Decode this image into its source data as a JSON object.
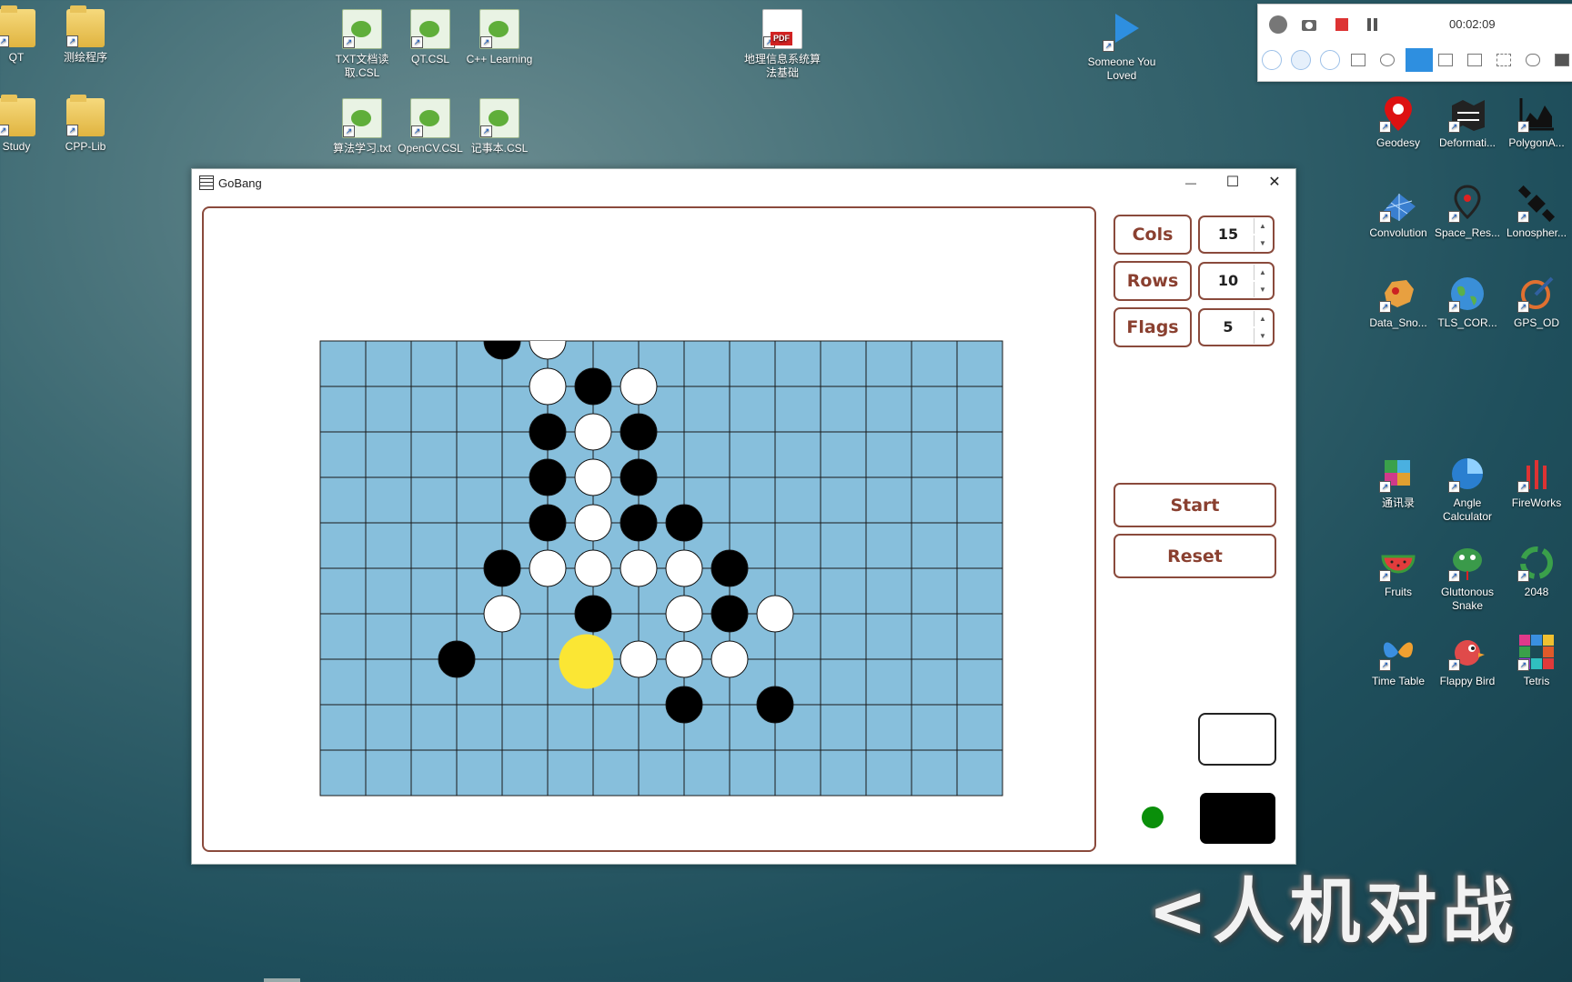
{
  "desktop": {
    "icons": [
      {
        "label": "QT"
      },
      {
        "label": "测绘程序"
      },
      {
        "label": "TXT文档读取.CSL"
      },
      {
        "label": "QT.CSL"
      },
      {
        "label": "C++ Learning"
      },
      {
        "label": "地理信息系统算法基础"
      },
      {
        "label": "Someone You Loved"
      },
      {
        "label": "Study"
      },
      {
        "label": "CPP-Lib"
      },
      {
        "label": "算法学习.txt"
      },
      {
        "label": "OpenCV.CSL"
      },
      {
        "label": "记事本.CSL"
      },
      {
        "label": "Geodesy"
      },
      {
        "label": "Deformati..."
      },
      {
        "label": "PolygonA..."
      },
      {
        "label": "Convolution"
      },
      {
        "label": "Space_Res..."
      },
      {
        "label": "Lonospher..."
      },
      {
        "label": "Data_Sno..."
      },
      {
        "label": "TLS_COR..."
      },
      {
        "label": "GPS_OD"
      },
      {
        "label": "通讯录"
      },
      {
        "label": "Angle Calculator"
      },
      {
        "label": "FireWorks"
      },
      {
        "label": "Fruits"
      },
      {
        "label": "Gluttonous Snake"
      },
      {
        "label": "2048"
      },
      {
        "label": "Time Table"
      },
      {
        "label": "Flappy Bird"
      },
      {
        "label": "Tetris"
      }
    ]
  },
  "recorder": {
    "time": "00:02:09"
  },
  "window": {
    "title": "GoBang",
    "controls": {
      "minimize": "—",
      "maximize": "☐",
      "close": "✕"
    }
  },
  "settings": {
    "cols_label": "Cols",
    "cols_value": "15",
    "rows_label": "Rows",
    "rows_value": "10",
    "flags_label": "Flags",
    "flags_value": "5"
  },
  "actions": {
    "start": "Start",
    "reset": "Reset"
  },
  "board": {
    "cols": 15,
    "rows": 10,
    "colors": {
      "background": "#87bfdc",
      "line": "#1a1a1a",
      "black": "#000000",
      "white": "#ffffff",
      "highlight": "#fbe634"
    },
    "stones": [
      {
        "c": 3,
        "r": 0,
        "color": "black"
      },
      {
        "c": 4,
        "r": 0,
        "color": "white"
      },
      {
        "c": 4,
        "r": 1,
        "color": "white"
      },
      {
        "c": 5,
        "r": 1,
        "color": "black"
      },
      {
        "c": 6,
        "r": 1,
        "color": "white"
      },
      {
        "c": 4,
        "r": 2,
        "color": "black"
      },
      {
        "c": 5,
        "r": 2,
        "color": "white"
      },
      {
        "c": 6,
        "r": 2,
        "color": "black"
      },
      {
        "c": 4,
        "r": 3,
        "color": "black"
      },
      {
        "c": 5,
        "r": 3,
        "color": "white"
      },
      {
        "c": 6,
        "r": 3,
        "color": "black"
      },
      {
        "c": 4,
        "r": 4,
        "color": "black"
      },
      {
        "c": 5,
        "r": 4,
        "color": "white"
      },
      {
        "c": 6,
        "r": 4,
        "color": "black"
      },
      {
        "c": 7,
        "r": 4,
        "color": "black"
      },
      {
        "c": 3,
        "r": 5,
        "color": "black"
      },
      {
        "c": 4,
        "r": 5,
        "color": "white"
      },
      {
        "c": 5,
        "r": 5,
        "color": "white"
      },
      {
        "c": 6,
        "r": 5,
        "color": "white"
      },
      {
        "c": 7,
        "r": 5,
        "color": "white"
      },
      {
        "c": 8,
        "r": 5,
        "color": "black"
      },
      {
        "c": 3,
        "r": 6,
        "color": "white"
      },
      {
        "c": 5,
        "r": 6,
        "color": "black"
      },
      {
        "c": 7,
        "r": 6,
        "color": "white"
      },
      {
        "c": 8,
        "r": 6,
        "color": "black"
      },
      {
        "c": 9,
        "r": 6,
        "color": "white"
      },
      {
        "c": 2,
        "r": 7,
        "color": "black"
      },
      {
        "c": 6,
        "r": 7,
        "color": "white"
      },
      {
        "c": 7,
        "r": 7,
        "color": "white"
      },
      {
        "c": 8,
        "r": 7,
        "color": "white"
      },
      {
        "c": 7,
        "r": 8,
        "color": "black"
      },
      {
        "c": 9,
        "r": 8,
        "color": "black"
      }
    ],
    "highlight": {
      "c": 4.85,
      "r": 7.05
    }
  },
  "status": {
    "turn_indicator_color": "#0a8f0a",
    "white_player_color": "#ffffff",
    "black_player_color": "#000000"
  },
  "overlay_caption": "<人机对战"
}
